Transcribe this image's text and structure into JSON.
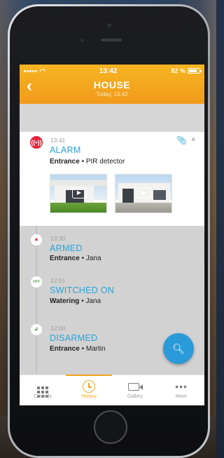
{
  "status_bar": {
    "time": "13:42",
    "battery": "82 %"
  },
  "header": {
    "back_icon": "chevron-left-icon",
    "title": "HOUSE",
    "subtitle": "Today, 13:42"
  },
  "alarm_event": {
    "time": "13:41",
    "title": "ALARM",
    "location": "Entrance",
    "separator": " • ",
    "source": "PIR detector",
    "icon": "alarm-siren-icon",
    "attachment_icon": "paperclip-icon",
    "collapse_icon": "chevron-up-icon"
  },
  "events": [
    {
      "time": "13:30",
      "title": "ARMED",
      "location": "Entrance",
      "source": "Jana",
      "icon": "lock-icon"
    },
    {
      "time": "12:51",
      "title": "SWITCHED ON",
      "location": "Watering",
      "source": "Jana",
      "icon": "off-badge-icon",
      "badge": "OFF"
    },
    {
      "time": "12:00",
      "title": "DISARMED",
      "location": "Entrance",
      "source": "Martin",
      "icon": "unlock-icon"
    }
  ],
  "fab": {
    "icon": "search-icon"
  },
  "tabs": [
    {
      "label": "Controls",
      "icon": "grid-icon",
      "active": false
    },
    {
      "label": "History",
      "icon": "clock-icon",
      "active": true
    },
    {
      "label": "Gallery",
      "icon": "video-camera-icon",
      "active": false
    },
    {
      "label": "More",
      "icon": "more-icon",
      "active": false
    }
  ],
  "colors": {
    "header_orange": "#f29a1c",
    "accent_blue": "#2aa3d6",
    "alarm_red": "#e5243b",
    "active_tab": "#f2a51e"
  }
}
